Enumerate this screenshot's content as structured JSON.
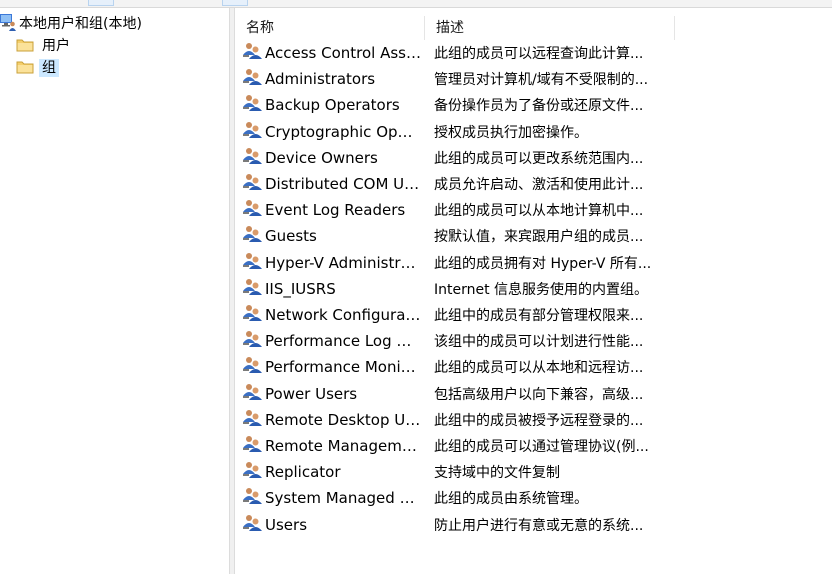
{
  "tree": {
    "root_label": "本地用户和组(本地)",
    "items": [
      {
        "label": "用户",
        "icon": "folder-icon",
        "selected": false
      },
      {
        "label": "组",
        "icon": "folder-icon",
        "selected": true
      }
    ]
  },
  "list": {
    "columns": [
      "名称",
      "描述"
    ],
    "rows": [
      {
        "name": "Access Control Assist...",
        "desc": "此组的成员可以远程查询此计算..."
      },
      {
        "name": "Administrators",
        "desc": "管理员对计算机/域有不受限制的..."
      },
      {
        "name": "Backup Operators",
        "desc": "备份操作员为了备份或还原文件..."
      },
      {
        "name": "Cryptographic Operat...",
        "desc": "授权成员执行加密操作。"
      },
      {
        "name": "Device Owners",
        "desc": "此组的成员可以更改系统范围内..."
      },
      {
        "name": "Distributed COM Users",
        "desc": "成员允许启动、激活和使用此计..."
      },
      {
        "name": "Event Log Readers",
        "desc": "此组的成员可以从本地计算机中..."
      },
      {
        "name": "Guests",
        "desc": "按默认值，来宾跟用户组的成员..."
      },
      {
        "name": "Hyper-V Administrat...",
        "desc": "此组的成员拥有对 Hyper-V 所有..."
      },
      {
        "name": "IIS_IUSRS",
        "desc": "Internet 信息服务使用的内置组。"
      },
      {
        "name": "Network Configuratio...",
        "desc": "此组中的成员有部分管理权限来..."
      },
      {
        "name": "Performance Log Users",
        "desc": "该组中的成员可以计划进行性能..."
      },
      {
        "name": "Performance Monitor...",
        "desc": "此组的成员可以从本地和远程访..."
      },
      {
        "name": "Power Users",
        "desc": "包括高级用户以向下兼容，高级..."
      },
      {
        "name": "Remote Desktop Users",
        "desc": "此组中的成员被授予远程登录的..."
      },
      {
        "name": "Remote Managemen...",
        "desc": "此组的成员可以通过管理协议(例..."
      },
      {
        "name": "Replicator",
        "desc": "支持域中的文件复制"
      },
      {
        "name": "System Managed Acc...",
        "desc": "此组的成员由系统管理。"
      },
      {
        "name": "Users",
        "desc": "防止用户进行有意或无意的系统..."
      }
    ]
  },
  "colors": {
    "selection": "#cce8ff",
    "folder": "#f5cf6b",
    "group_icon": "#3a6fc4"
  },
  "icons": {
    "root": "computer-users-icon",
    "row": "group-icon"
  }
}
